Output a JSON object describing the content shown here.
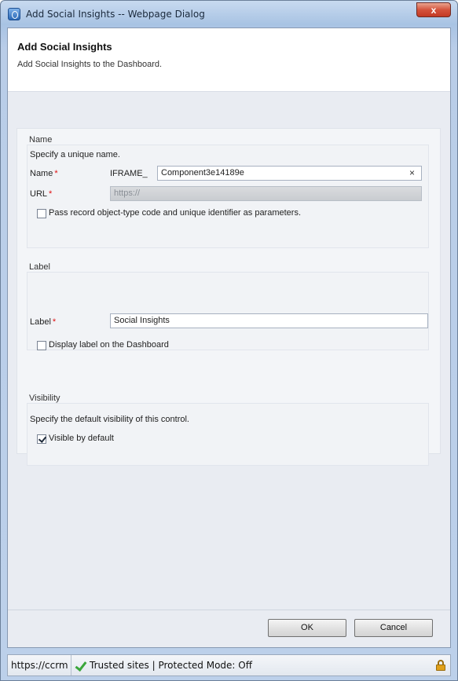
{
  "window": {
    "title": "Add Social Insights -- Webpage Dialog",
    "close_label": "x"
  },
  "header": {
    "title": "Add Social Insights",
    "description": "Add Social Insights to the Dashboard."
  },
  "name_section": {
    "title": "Name",
    "hint": "Specify a unique name.",
    "name_label": "Name",
    "required_mark": "*",
    "name_prefix": "IFRAME_",
    "name_value": "Component3e14189e",
    "clear_label": "×",
    "url_label": "URL",
    "url_value": "https://",
    "pass_params_label": "Pass record object-type code and unique identifier as parameters.",
    "pass_params_checked": false
  },
  "label_section": {
    "title": "Label",
    "label_label": "Label",
    "label_value": "Social Insights",
    "display_label_text": "Display label on the Dashboard",
    "display_label_checked": false
  },
  "visibility_section": {
    "title": "Visibility",
    "hint": "Specify the default visibility of this control.",
    "visible_label": "Visible by default",
    "visible_checked": true
  },
  "buttons": {
    "ok": "OK",
    "cancel": "Cancel"
  },
  "statusbar": {
    "url": "https://ccrm",
    "zone": "Trusted sites | Protected Mode: Off"
  }
}
